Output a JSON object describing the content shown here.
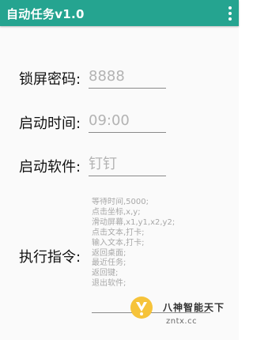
{
  "toolbar": {
    "title": "自动任务v1.0",
    "menu_icon": "more-vert-icon"
  },
  "form": {
    "lock_password": {
      "label": "锁屏密码:",
      "placeholder": "8888"
    },
    "start_time": {
      "label": "启动时间:",
      "placeholder": "09:00"
    },
    "start_app": {
      "label": "启动软件:",
      "placeholder": "钉钉"
    },
    "commands": {
      "label": "执行指令:",
      "lines": [
        "等待时间,5000;",
        "点击坐标,x,y;",
        "滑动屏幕,x1,y1,x2,y2;",
        "点击文本,打卡;",
        "输入文本,打卡;",
        "返回桌面;",
        "最近任务;",
        "返回键;",
        "退出软件;"
      ]
    }
  },
  "watermark": {
    "text": "八神智能天下",
    "url": "zntx.cc"
  },
  "colors": {
    "toolbar": "#25a490",
    "placeholder": "#b3b3b3",
    "underline": "#8a8a8a"
  }
}
